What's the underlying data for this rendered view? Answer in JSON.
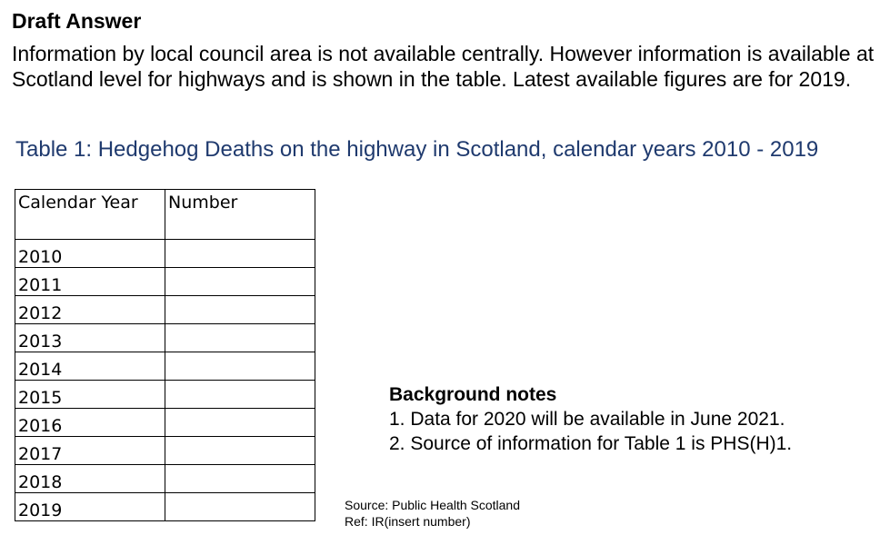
{
  "heading": "Draft Answer",
  "intro": "Information by local council area is not available centrally. However information is available at Scotland level for highways and is shown in the table. Latest available figures are for 2019.",
  "table_title": "Table 1: Hedgehog Deaths on the highway in Scotland, calendar years 2010 - 2019",
  "table": {
    "headers": [
      "Calendar Year",
      "Number"
    ],
    "rows": [
      [
        "2010",
        ""
      ],
      [
        "2011",
        ""
      ],
      [
        "2012",
        ""
      ],
      [
        "2013",
        ""
      ],
      [
        "2014",
        ""
      ],
      [
        "2015",
        ""
      ],
      [
        "2016",
        ""
      ],
      [
        "2017",
        ""
      ],
      [
        "2018",
        ""
      ],
      [
        "2019",
        ""
      ]
    ]
  },
  "notes": {
    "title": "Background notes",
    "items": [
      "1. Data for 2020 will be available in June 2021.",
      "2. Source of information for Table 1 is PHS(H)1."
    ]
  },
  "source": {
    "line1": "Source: Public Health Scotland",
    "line2": "Ref: IR(insert number)"
  }
}
